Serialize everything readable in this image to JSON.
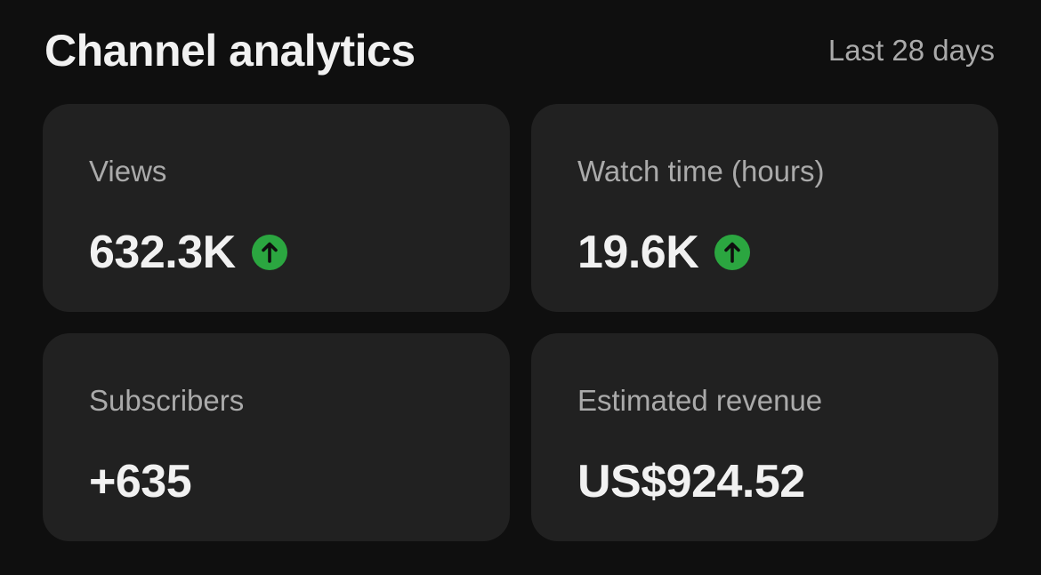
{
  "header": {
    "title": "Channel analytics",
    "period": "Last 28 days"
  },
  "cards": [
    {
      "label": "Views",
      "value": "632.3K",
      "trend": "up",
      "trend_icon": "arrow-up-circle-icon"
    },
    {
      "label": "Watch time (hours)",
      "value": "19.6K",
      "trend": "up",
      "trend_icon": "arrow-up-circle-icon"
    },
    {
      "label": "Subscribers",
      "value": "+635"
    },
    {
      "label": "Estimated revenue",
      "value": "US$924.52"
    }
  ],
  "colors": {
    "background": "#0f0f0f",
    "card": "#212121",
    "primary_text": "#f1f1f1",
    "secondary_text": "#aaaaaa",
    "trend_up": "#2ba640"
  }
}
